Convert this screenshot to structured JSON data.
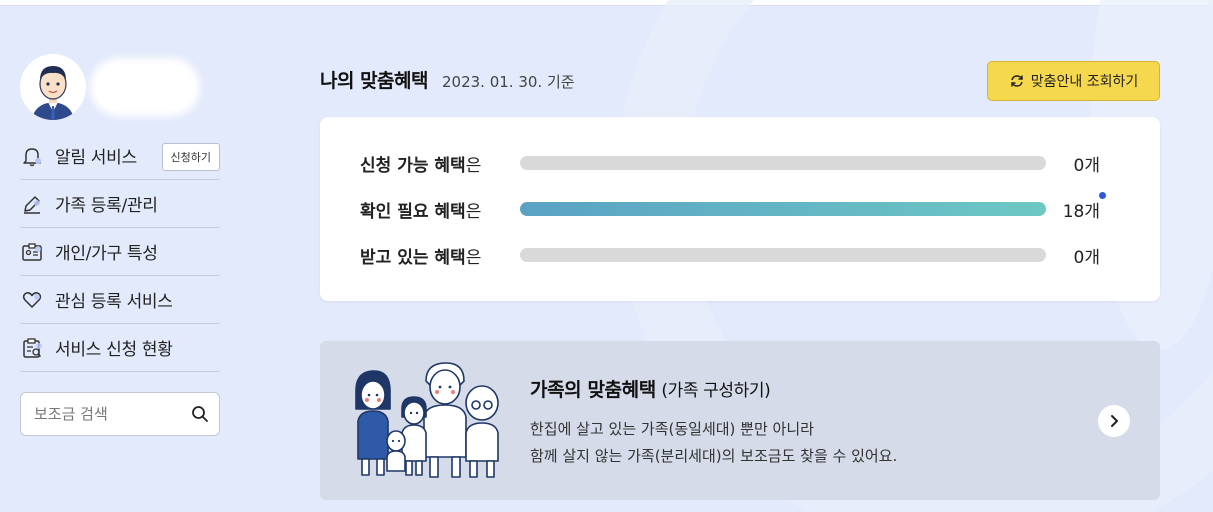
{
  "sidebar": {
    "menu": [
      {
        "label": "알림 서비스",
        "icon": "bell-icon",
        "action": "신청하기"
      },
      {
        "label": "가족 등록/관리",
        "icon": "pencil-icon"
      },
      {
        "label": "개인/가구 특성",
        "icon": "id-card-icon"
      },
      {
        "label": "관심 등록 서비스",
        "icon": "heart-icon"
      },
      {
        "label": "서비스 신청 현황",
        "icon": "clipboard-icon"
      }
    ],
    "search": {
      "placeholder": "보조금 검색",
      "icon": "search-icon"
    }
  },
  "header": {
    "title": "나의 맞춤혜택",
    "date": "2023. 01. 30. 기준",
    "lookup_button": "맞춤안내 조회하기"
  },
  "benefits": {
    "suffix": "은",
    "rows": [
      {
        "label": "신청 가능 혜택",
        "count": "0개",
        "fill": 0
      },
      {
        "label": "확인 필요 혜택",
        "count": "18개",
        "fill": 1,
        "new": true
      },
      {
        "label": "받고 있는 혜택",
        "count": "0개",
        "fill": 0
      }
    ]
  },
  "family_banner": {
    "title": "가족의 맞춤혜택",
    "subtitle": "(가족 구성하기)",
    "line1": "한집에 살고 있는 가족(동일세대) 뿐만 아니라",
    "line2": "함께 살지 않는 가족(분리세대)의 보조금도 찾을 수 있어요."
  },
  "colors": {
    "background": "#e3eafb",
    "accent_yellow": "#f6d84e",
    "bar_fill": "#5aa2c4",
    "bar_track": "#d9d9d9",
    "new_dot": "#2f56e0"
  }
}
